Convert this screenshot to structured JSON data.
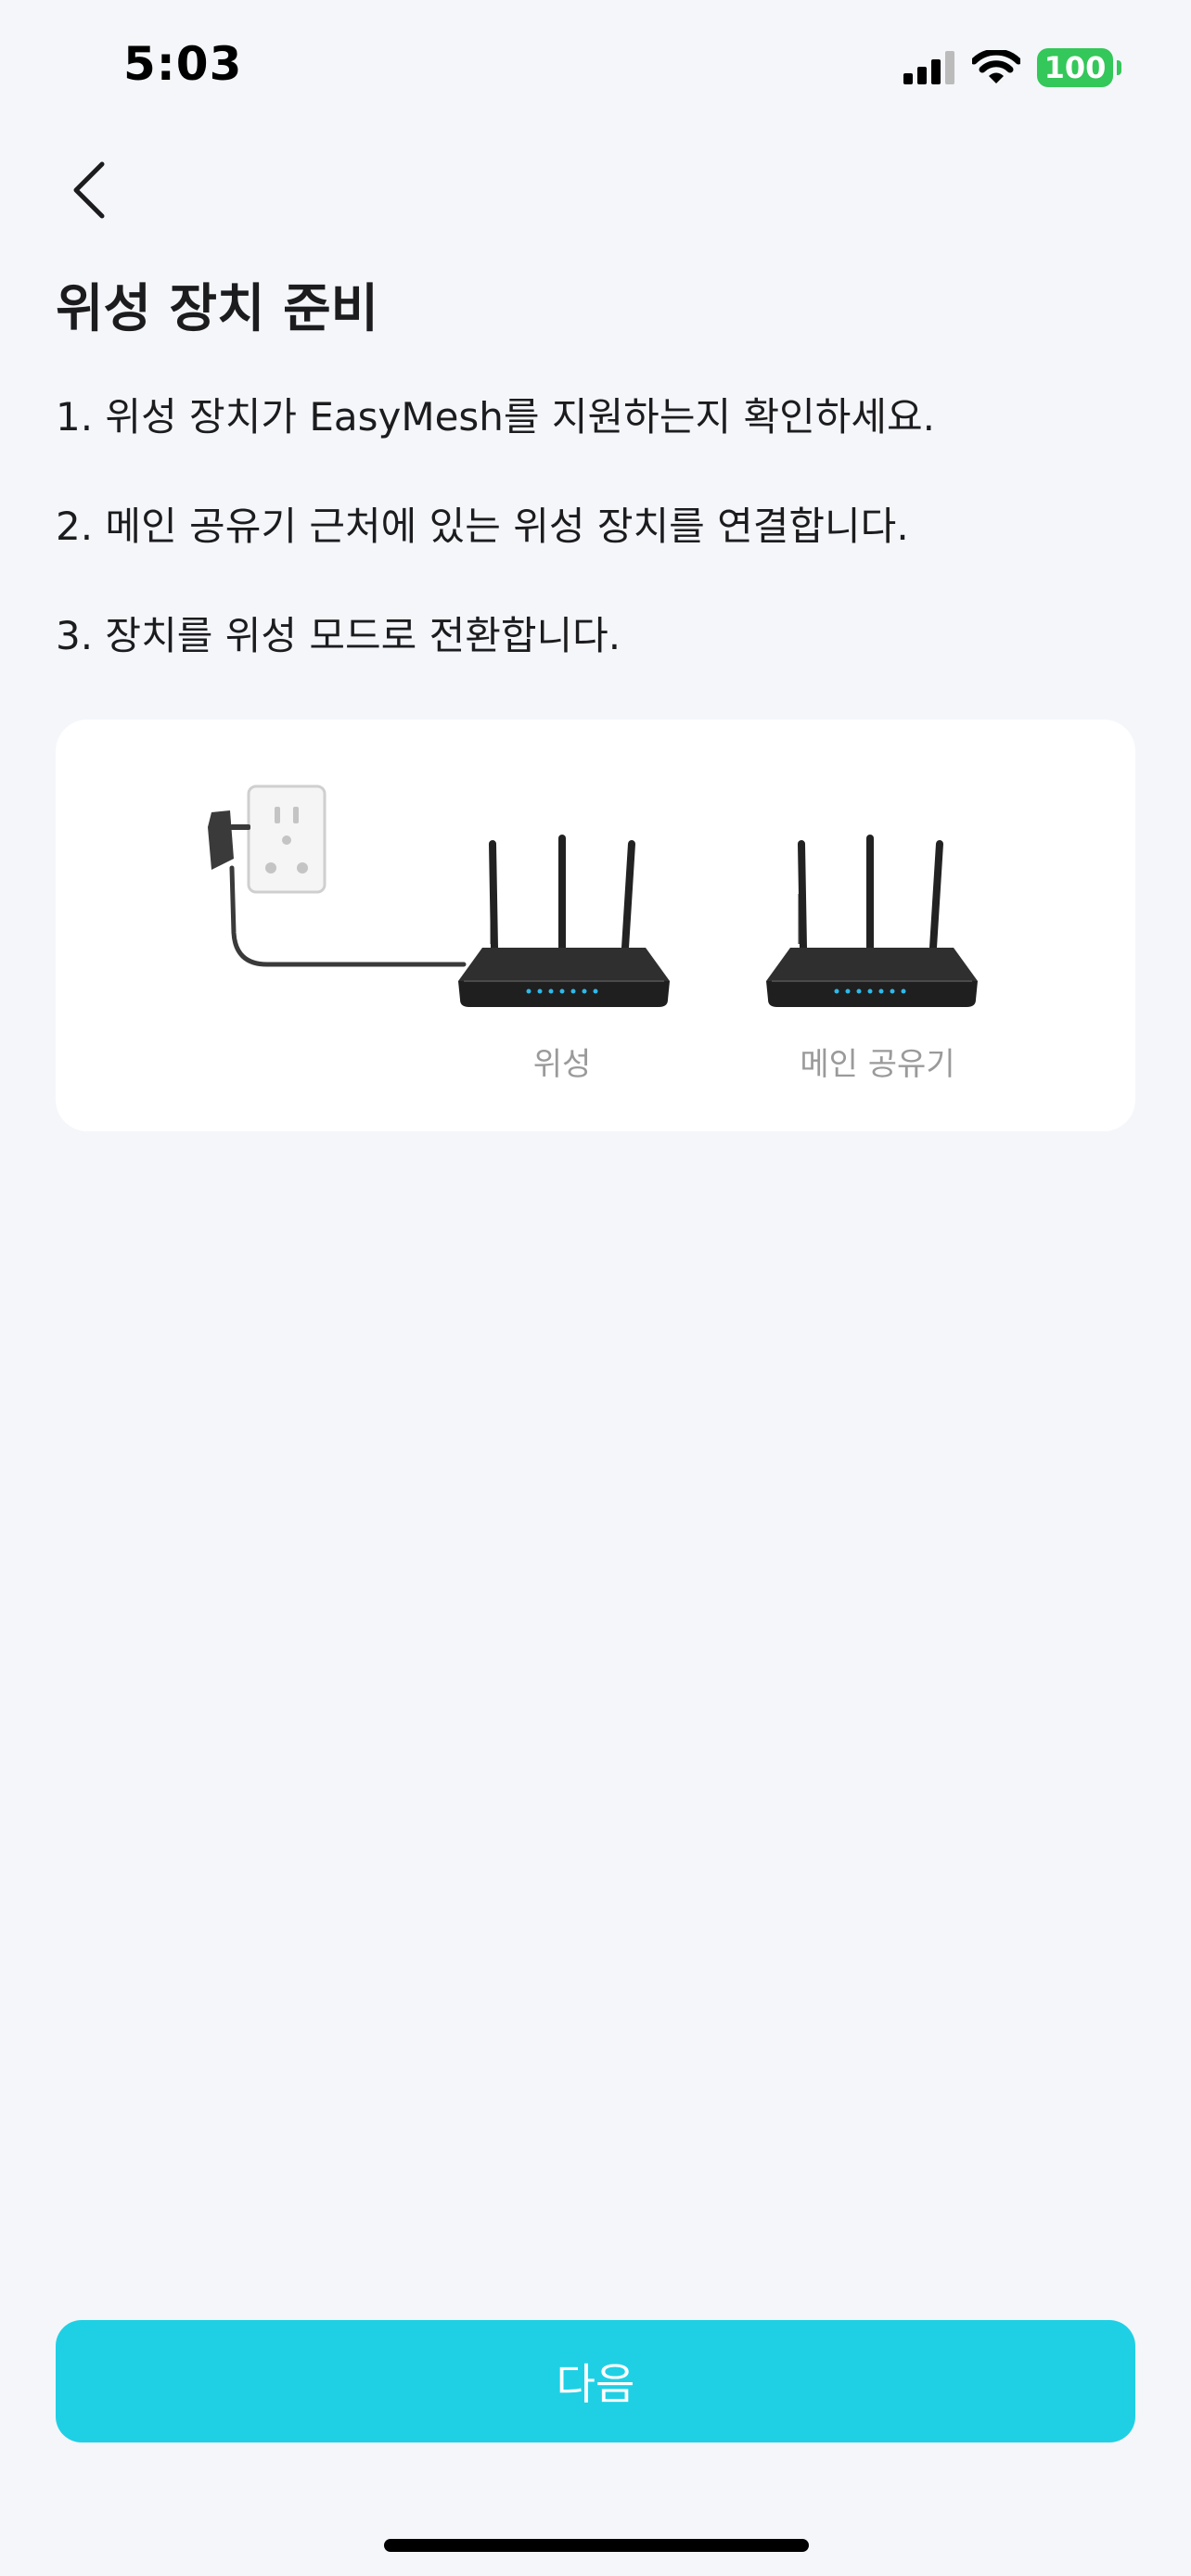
{
  "status_bar": {
    "time": "5:03",
    "battery": "100",
    "icons": [
      "cellular-signal-icon",
      "wifi-icon",
      "battery-icon"
    ],
    "battery_color": "#34c759"
  },
  "header": {
    "back_icon": "chevron-left-icon",
    "title": "위성 장치 준비"
  },
  "steps": [
    "1. 위성 장치가 EasyMesh를 지원하는지 확인하세요.",
    "2. 메인 공유기 근처에 있는 위성 장치를 연결합니다.",
    "3. 장치를 위성 모드로 전환합니다."
  ],
  "illustration": {
    "satellite_label": "위성",
    "main_router_label": "메인 공유기"
  },
  "footer": {
    "next_label": "다음",
    "accent_color": "#1fd0e5"
  }
}
